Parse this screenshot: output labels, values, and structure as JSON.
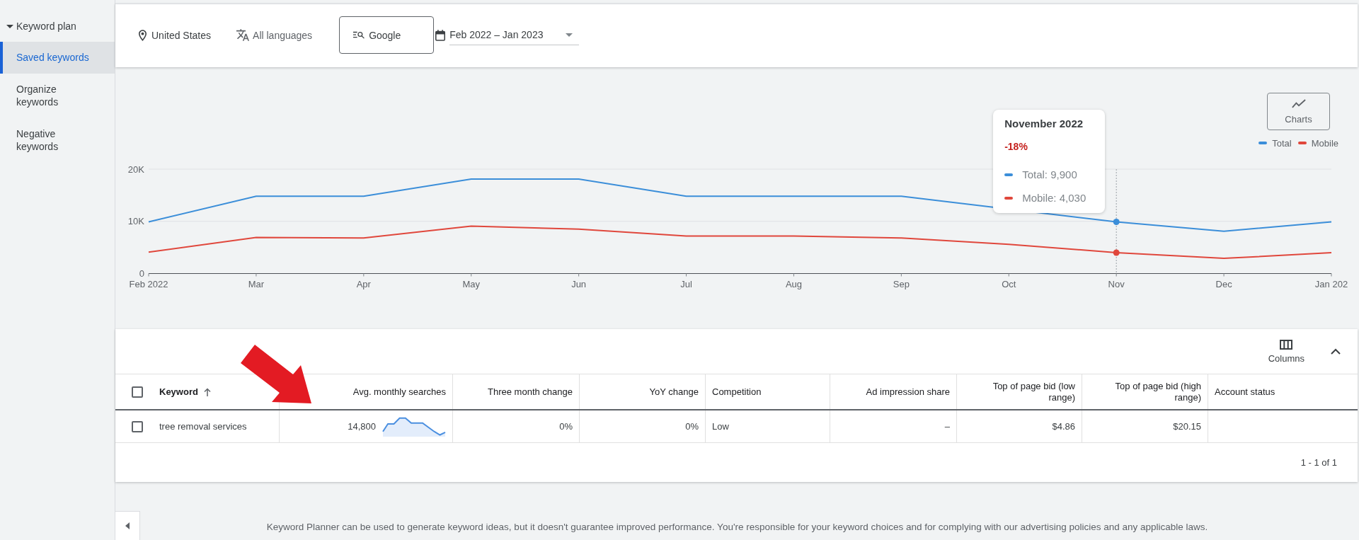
{
  "sidebar": {
    "group": {
      "label": "Keyword plan",
      "expanded": true
    },
    "items": [
      {
        "label": "Saved keywords",
        "selected": true
      },
      {
        "label": "Organize keywords",
        "selected": false
      },
      {
        "label": "Negative keywords",
        "selected": false
      }
    ]
  },
  "filters": {
    "location": "United States",
    "language": "All languages",
    "network": "Google",
    "date_range": "Feb 2022 – Jan 2023"
  },
  "chart_panel": {
    "charts_button": "Charts",
    "chart_data": {
      "type": "line",
      "categories": [
        "Feb 2022",
        "Mar",
        "Apr",
        "May",
        "Jun",
        "Jul",
        "Aug",
        "Sep",
        "Oct",
        "Nov",
        "Dec",
        "Jan 202"
      ],
      "series": [
        {
          "name": "Total",
          "color": "#3b8ed9",
          "values": [
            9900,
            14800,
            14800,
            18100,
            18100,
            14800,
            14800,
            14800,
            null,
            9900,
            8100,
            9900
          ]
        },
        {
          "name": "Mobile",
          "color": "#e0473c",
          "values": [
            4100,
            6900,
            6800,
            9100,
            8500,
            7200,
            7200,
            6800,
            5600,
            4000,
            2900,
            4000
          ]
        }
      ],
      "ylim": [
        0,
        20000
      ],
      "yticks": [
        0,
        {
          "value": 10000,
          "label": "10K"
        },
        {
          "value": 20000,
          "label": "20K"
        }
      ],
      "ref_lines": [
        {
          "axis": "y",
          "value": 10000
        },
        {
          "axis": "y",
          "value": 20000
        },
        {
          "axis": "x",
          "value": "Nov"
        }
      ]
    },
    "tooltip": {
      "title": "November 2022",
      "change": "-18%",
      "negative": true,
      "lines": [
        "Total: 9,900",
        "Mobile: 4,030"
      ]
    }
  },
  "table": {
    "columns_button": "Columns",
    "expanded": true,
    "header_checkbox": {
      "checked": false
    },
    "columns": [
      {
        "label": "Keyword",
        "kind": "text",
        "sorted": true
      },
      {
        "label": "Avg. monthly searches",
        "kind": "searches",
        "sorted": false
      },
      {
        "label": "Three month change",
        "kind": "number",
        "sorted": false
      },
      {
        "label": "YoY change",
        "kind": "number",
        "sorted": false
      },
      {
        "label": "Competition",
        "kind": "text",
        "sorted": false
      },
      {
        "label": "Ad impression share",
        "kind": "number",
        "sorted": false
      },
      {
        "label": "Top of page bid (low range)",
        "kind": "number",
        "sorted": false
      },
      {
        "label": "Top of page bid (high range)",
        "kind": "number",
        "sorted": false
      },
      {
        "label": "Account status",
        "kind": "text",
        "sorted": false
      }
    ],
    "rows": [
      {
        "checked": false,
        "cells": [
          "tree removal services",
          "14,800",
          "0%",
          "0%",
          "Low",
          "–",
          "$4.86",
          "$20.15"
        ]
      }
    ],
    "pagination": "1 - 1 of 1"
  },
  "footer": {
    "disclaimer": "Keyword Planner can be used to generate keyword ideas, but it doesn't guarantee improved performance. You're responsible for your keyword choices and for complying with our advertising policies and any applicable laws."
  }
}
